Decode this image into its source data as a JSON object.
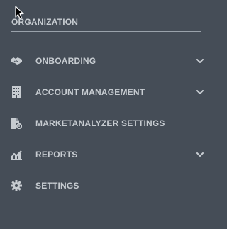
{
  "sidebar": {
    "section_title": "ORGANIZATION",
    "items": [
      {
        "label": "ONBOARDING",
        "icon": "handshake-icon",
        "expandable": true
      },
      {
        "label": "ACCOUNT MANAGEMENT",
        "icon": "building-icon",
        "expandable": true
      },
      {
        "label": "MARKETANALYZER SETTINGS",
        "icon": "file-settings-icon",
        "expandable": false
      },
      {
        "label": "REPORTS",
        "icon": "chart-icon",
        "expandable": true
      },
      {
        "label": "SETTINGS",
        "icon": "gear-icon",
        "expandable": false
      }
    ]
  },
  "colors": {
    "background": "#454d57",
    "text": "#c7ccd1",
    "divider": "#9aa2ab"
  }
}
